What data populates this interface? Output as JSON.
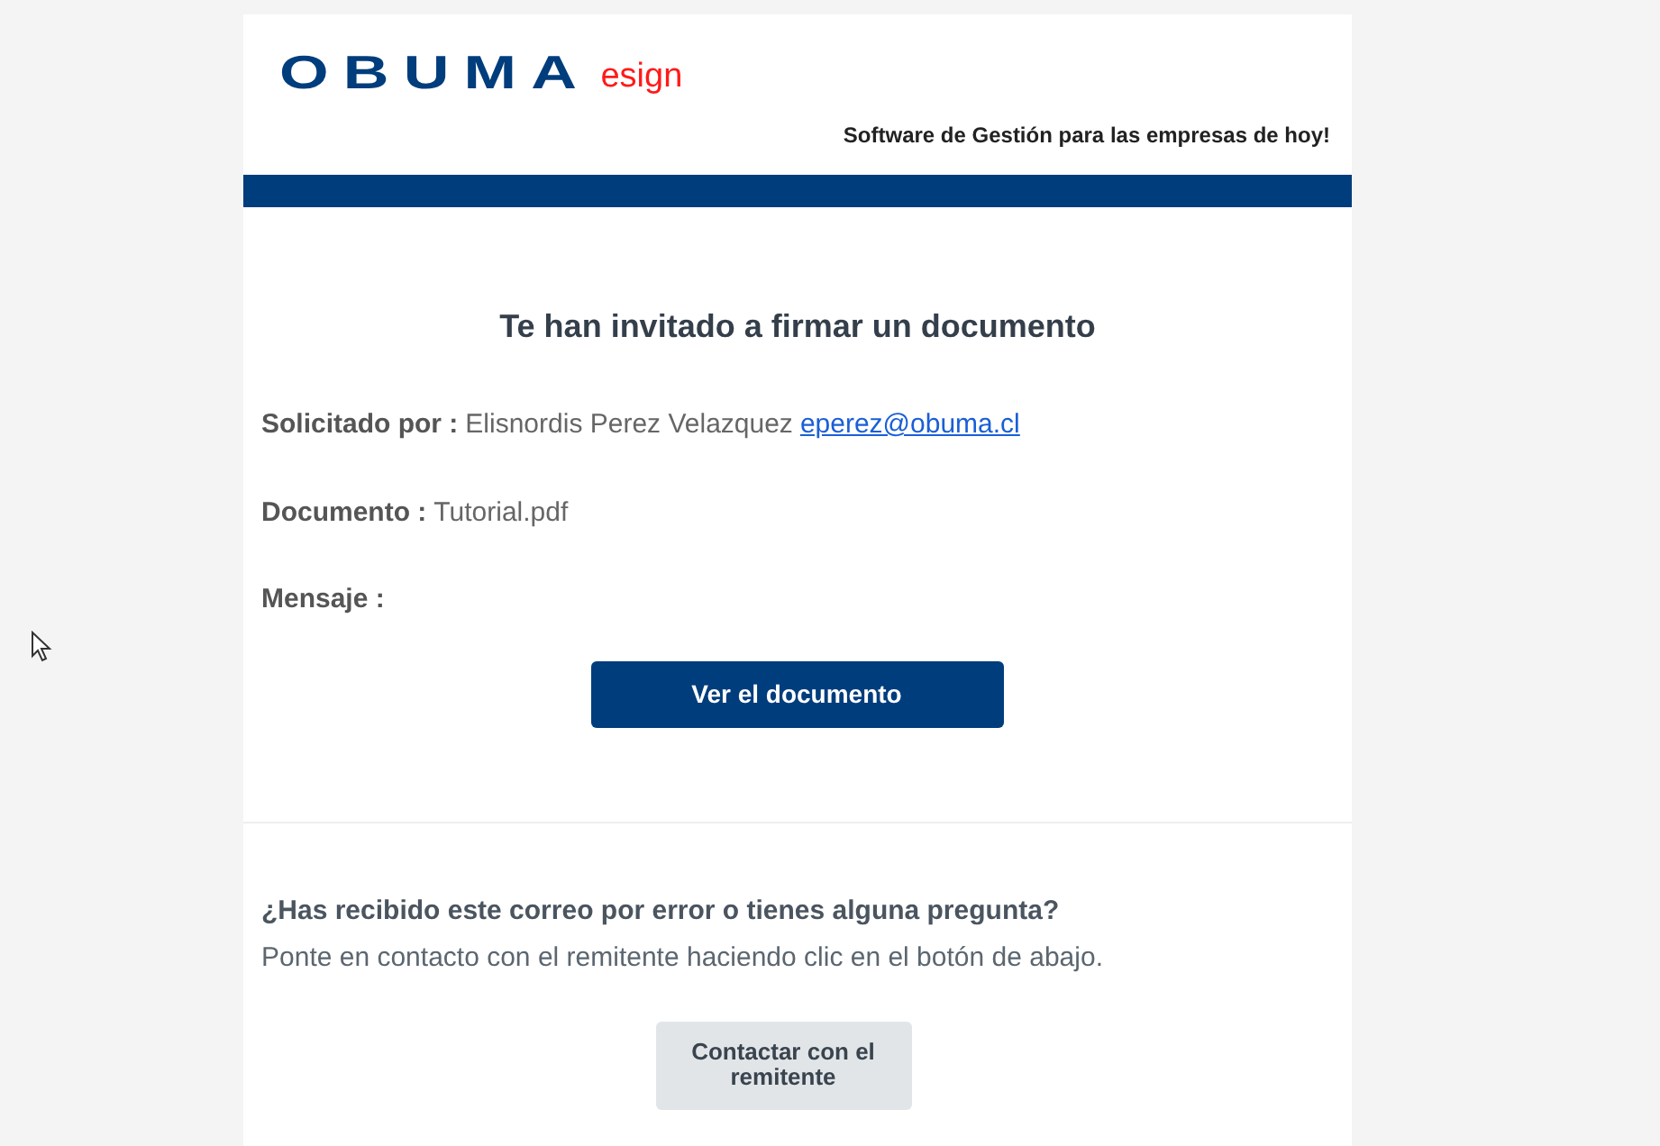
{
  "header": {
    "brand": "OBUMA",
    "product": "esign",
    "tagline": "Software de Gestión para las empresas de hoy!"
  },
  "title": "Te han invitado a firmar un documento",
  "fields": [
    {
      "label": "Solicitado por :",
      "value": "Elisnordis Perez Velazquez",
      "link": "eperez@obuma.cl"
    },
    {
      "label": "Documento :",
      "value": "Tutorial.pdf"
    },
    {
      "label": "Mensaje :"
    }
  ],
  "primary_button": "Ver el documento",
  "help": {
    "question": "¿Has recibido este correo por error o tienes alguna pregunta?",
    "text": "Ponte en contacto con el remitente haciendo clic en el botón de abajo."
  },
  "contact_button": "Contactar con el remitente"
}
